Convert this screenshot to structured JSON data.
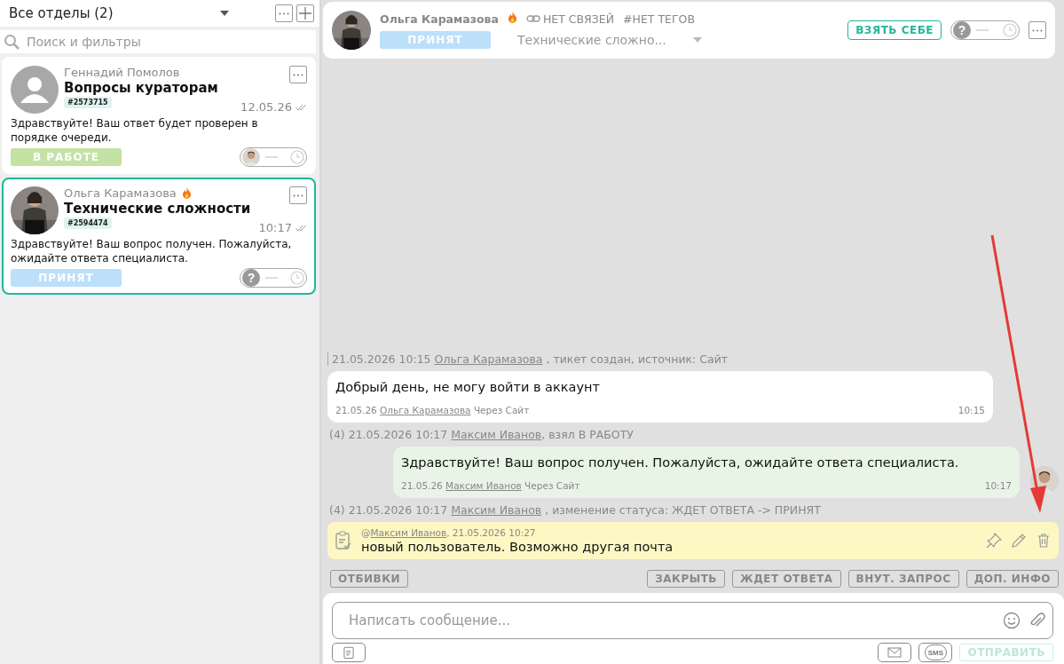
{
  "sidebar": {
    "department": "Все отделы (2)",
    "search_placeholder": "Поиск и фильтры",
    "tickets": [
      {
        "author": "Геннадий Помолов",
        "urgent": false,
        "avatar": {
          "kind": "silhouette"
        },
        "subject": "Вопросы кураторам",
        "number": "#2573715",
        "time": "12.05.26",
        "preview": "Здравствуйте! Ваш ответ будет проверен в порядке очереди.",
        "status": {
          "label": "В РАБОТЕ",
          "kind": "work"
        },
        "assignee": {
          "kind": "agent"
        },
        "selected": false
      },
      {
        "author": "Ольга Карамазова",
        "urgent": true,
        "subject": "Технические сложности",
        "number": "#2594474",
        "time": "10:17",
        "preview": "Здравствуйте! Ваш вопрос получен. Пожалуйста, ожидайте ответа специалиста.",
        "status": {
          "label": "ПРИНЯТ",
          "kind": "accepted"
        },
        "assignee": {
          "kind": "unknown",
          "label": "?"
        },
        "selected": true
      }
    ]
  },
  "header": {
    "author": "Ольга Карамазова",
    "urgent": true,
    "links": "НЕТ СВЯЗЕЙ",
    "tags": "#НЕТ ТЕГОВ",
    "status": {
      "label": "ПРИНЯТ",
      "kind": "accepted"
    },
    "topic": "Технические сложно...",
    "take_button": "ВЗЯТЬ СЕБЕ",
    "assignee": {
      "kind": "unknown",
      "label": "?"
    }
  },
  "feed": [
    {
      "kind": "event",
      "datetime": "21.05.2026 10:15",
      "author": "Ольга Карамазова",
      "rest": " , тикет создан, источник: Сайт"
    },
    {
      "kind": "incoming",
      "text": "Добрый день, не могу войти в аккаунт",
      "date": "21.05.26",
      "author": "Ольга Карамазова",
      "via": "Через Сайт",
      "time": "10:15"
    },
    {
      "kind": "event",
      "count": "(4)",
      "datetime": "21.05.2026 10:17",
      "author": "Максим Иванов",
      "rest": ", взял В РАБОТУ"
    },
    {
      "kind": "outgoing",
      "text": "Здравствуйте! Ваш вопрос получен. Пожалуйста, ожидайте ответа специалиста.",
      "date": "21.05.26",
      "author": "Максим Иванов",
      "via": "Через Сайт",
      "time": "10:17"
    },
    {
      "kind": "event",
      "count": "(4)",
      "datetime": "21.05.2026 10:17",
      "author": "Максим Иванов",
      "rest": " , изменение статуса: ЖДЕТ ОТВЕТА -> ПРИНЯТ"
    },
    {
      "kind": "note",
      "at": "@",
      "author": "Максим Иванов",
      "datetime": ", 21.05.2026 10:27",
      "text": "новый пользователь. Возможно другая почта"
    }
  ],
  "actions": {
    "left": [
      "ОТБИВКИ"
    ],
    "right": [
      "ЗАКРЫТЬ",
      "ЖДЕТ ОТВЕТА",
      "ВНУТ. ЗАПРОС",
      "ДОП. ИНФО"
    ]
  },
  "composer": {
    "placeholder": "Написать сообщение...",
    "sms": "SMS",
    "send": "ОТПРАВИТЬ",
    "send_disabled": true
  }
}
